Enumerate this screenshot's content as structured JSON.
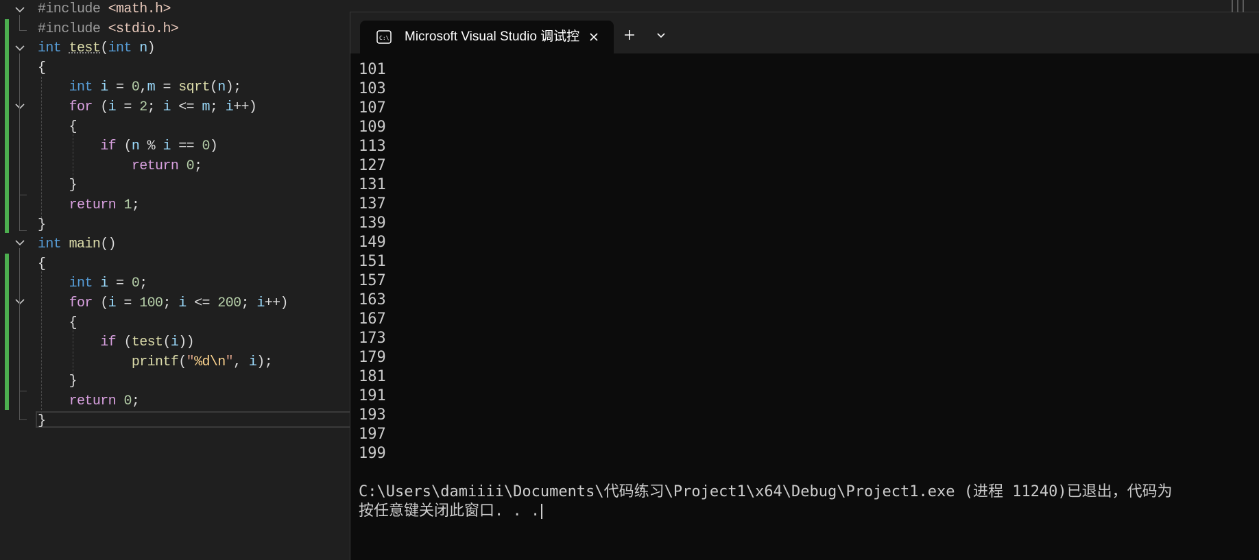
{
  "editor": {
    "lines": [
      [
        [
          "pp",
          "#include "
        ],
        [
          "inc",
          "<math.h>"
        ]
      ],
      [
        [
          "pp",
          "#include "
        ],
        [
          "inc",
          "<stdio.h>"
        ]
      ],
      [
        [
          "kw",
          "int "
        ],
        [
          "fn fn-test",
          "test"
        ],
        [
          "txt",
          "("
        ],
        [
          "kw",
          "int "
        ],
        [
          "par",
          "n"
        ],
        [
          "txt",
          ")"
        ]
      ],
      [
        [
          "txt",
          "{"
        ]
      ],
      [
        [
          "txt",
          "    "
        ],
        [
          "kw",
          "int "
        ],
        [
          "par",
          "i"
        ],
        [
          "txt",
          " = "
        ],
        [
          "num",
          "0"
        ],
        [
          "txt",
          ","
        ],
        [
          "par",
          "m"
        ],
        [
          "txt",
          " = "
        ],
        [
          "fn",
          "sqrt"
        ],
        [
          "txt",
          "("
        ],
        [
          "par",
          "n"
        ],
        [
          "txt",
          ");"
        ]
      ],
      [
        [
          "txt",
          "    "
        ],
        [
          "ctl",
          "for "
        ],
        [
          "txt",
          "("
        ],
        [
          "par",
          "i"
        ],
        [
          "txt",
          " = "
        ],
        [
          "num",
          "2"
        ],
        [
          "txt",
          "; "
        ],
        [
          "par",
          "i"
        ],
        [
          "txt",
          " <= "
        ],
        [
          "par",
          "m"
        ],
        [
          "txt",
          "; "
        ],
        [
          "par",
          "i"
        ],
        [
          "txt",
          "++)"
        ]
      ],
      [
        [
          "txt",
          "    {"
        ]
      ],
      [
        [
          "txt",
          "        "
        ],
        [
          "ctl",
          "if "
        ],
        [
          "txt",
          "("
        ],
        [
          "par",
          "n"
        ],
        [
          "txt",
          " % "
        ],
        [
          "par",
          "i"
        ],
        [
          "txt",
          " == "
        ],
        [
          "num",
          "0"
        ],
        [
          "txt",
          ")"
        ]
      ],
      [
        [
          "txt",
          "            "
        ],
        [
          "ctl",
          "return "
        ],
        [
          "num",
          "0"
        ],
        [
          "txt",
          ";"
        ]
      ],
      [
        [
          "txt",
          "    }"
        ]
      ],
      [
        [
          "txt",
          "    "
        ],
        [
          "ctl",
          "return "
        ],
        [
          "num",
          "1"
        ],
        [
          "txt",
          ";"
        ]
      ],
      [
        [
          "txt",
          "}"
        ]
      ],
      [
        [
          "kw",
          "int "
        ],
        [
          "fn",
          "main"
        ],
        [
          "txt",
          "()"
        ]
      ],
      [
        [
          "txt",
          "{"
        ]
      ],
      [
        [
          "txt",
          "    "
        ],
        [
          "kw",
          "int "
        ],
        [
          "par",
          "i"
        ],
        [
          "txt",
          " = "
        ],
        [
          "num",
          "0"
        ],
        [
          "txt",
          ";"
        ]
      ],
      [
        [
          "txt",
          "    "
        ],
        [
          "ctl",
          "for "
        ],
        [
          "txt",
          "("
        ],
        [
          "par",
          "i"
        ],
        [
          "txt",
          " = "
        ],
        [
          "num",
          "100"
        ],
        [
          "txt",
          "; "
        ],
        [
          "par",
          "i"
        ],
        [
          "txt",
          " <= "
        ],
        [
          "num",
          "200"
        ],
        [
          "txt",
          "; "
        ],
        [
          "par",
          "i"
        ],
        [
          "txt",
          "++)"
        ]
      ],
      [
        [
          "txt",
          "    {"
        ]
      ],
      [
        [
          "txt",
          "        "
        ],
        [
          "ctl",
          "if "
        ],
        [
          "txt",
          "("
        ],
        [
          "fn",
          "test"
        ],
        [
          "txt",
          "("
        ],
        [
          "par",
          "i"
        ],
        [
          "txt",
          "))"
        ]
      ],
      [
        [
          "txt",
          "            "
        ],
        [
          "fn",
          "printf"
        ],
        [
          "txt",
          "("
        ],
        [
          "str",
          "\""
        ],
        [
          "esc",
          "%d\\n"
        ],
        [
          "str",
          "\""
        ],
        [
          "txt",
          ", "
        ],
        [
          "par",
          "i"
        ],
        [
          "txt",
          ");"
        ]
      ],
      [
        [
          "txt",
          "    }"
        ]
      ],
      [
        [
          "txt",
          "    "
        ],
        [
          "ctl",
          "return "
        ],
        [
          "num",
          "0"
        ],
        [
          "txt",
          ";"
        ]
      ],
      [
        [
          "txt",
          "}"
        ]
      ]
    ]
  },
  "console": {
    "tab_title": "Microsoft Visual Studio 调试控",
    "tab_icon": "terminal-icon",
    "output_lines": [
      "101",
      "103",
      "107",
      "109",
      "113",
      "127",
      "131",
      "137",
      "139",
      "149",
      "151",
      "157",
      "163",
      "167",
      "173",
      "179",
      "181",
      "191",
      "193",
      "197",
      "199"
    ],
    "exit_message": "C:\\Users\\damiiii\\Documents\\代码练习\\Project1\\x64\\Debug\\Project1.exe (进程 11240)已退出，代码为",
    "press_key_message": "按任意键关闭此窗口. . ."
  },
  "colors": {
    "keyword": "#569cd6",
    "control": "#d8a0df",
    "function": "#dcdcaa",
    "number": "#b5cea8",
    "string": "#d69d85",
    "change_bar": "#4cae4f",
    "console_bg": "#0c0c0c"
  }
}
